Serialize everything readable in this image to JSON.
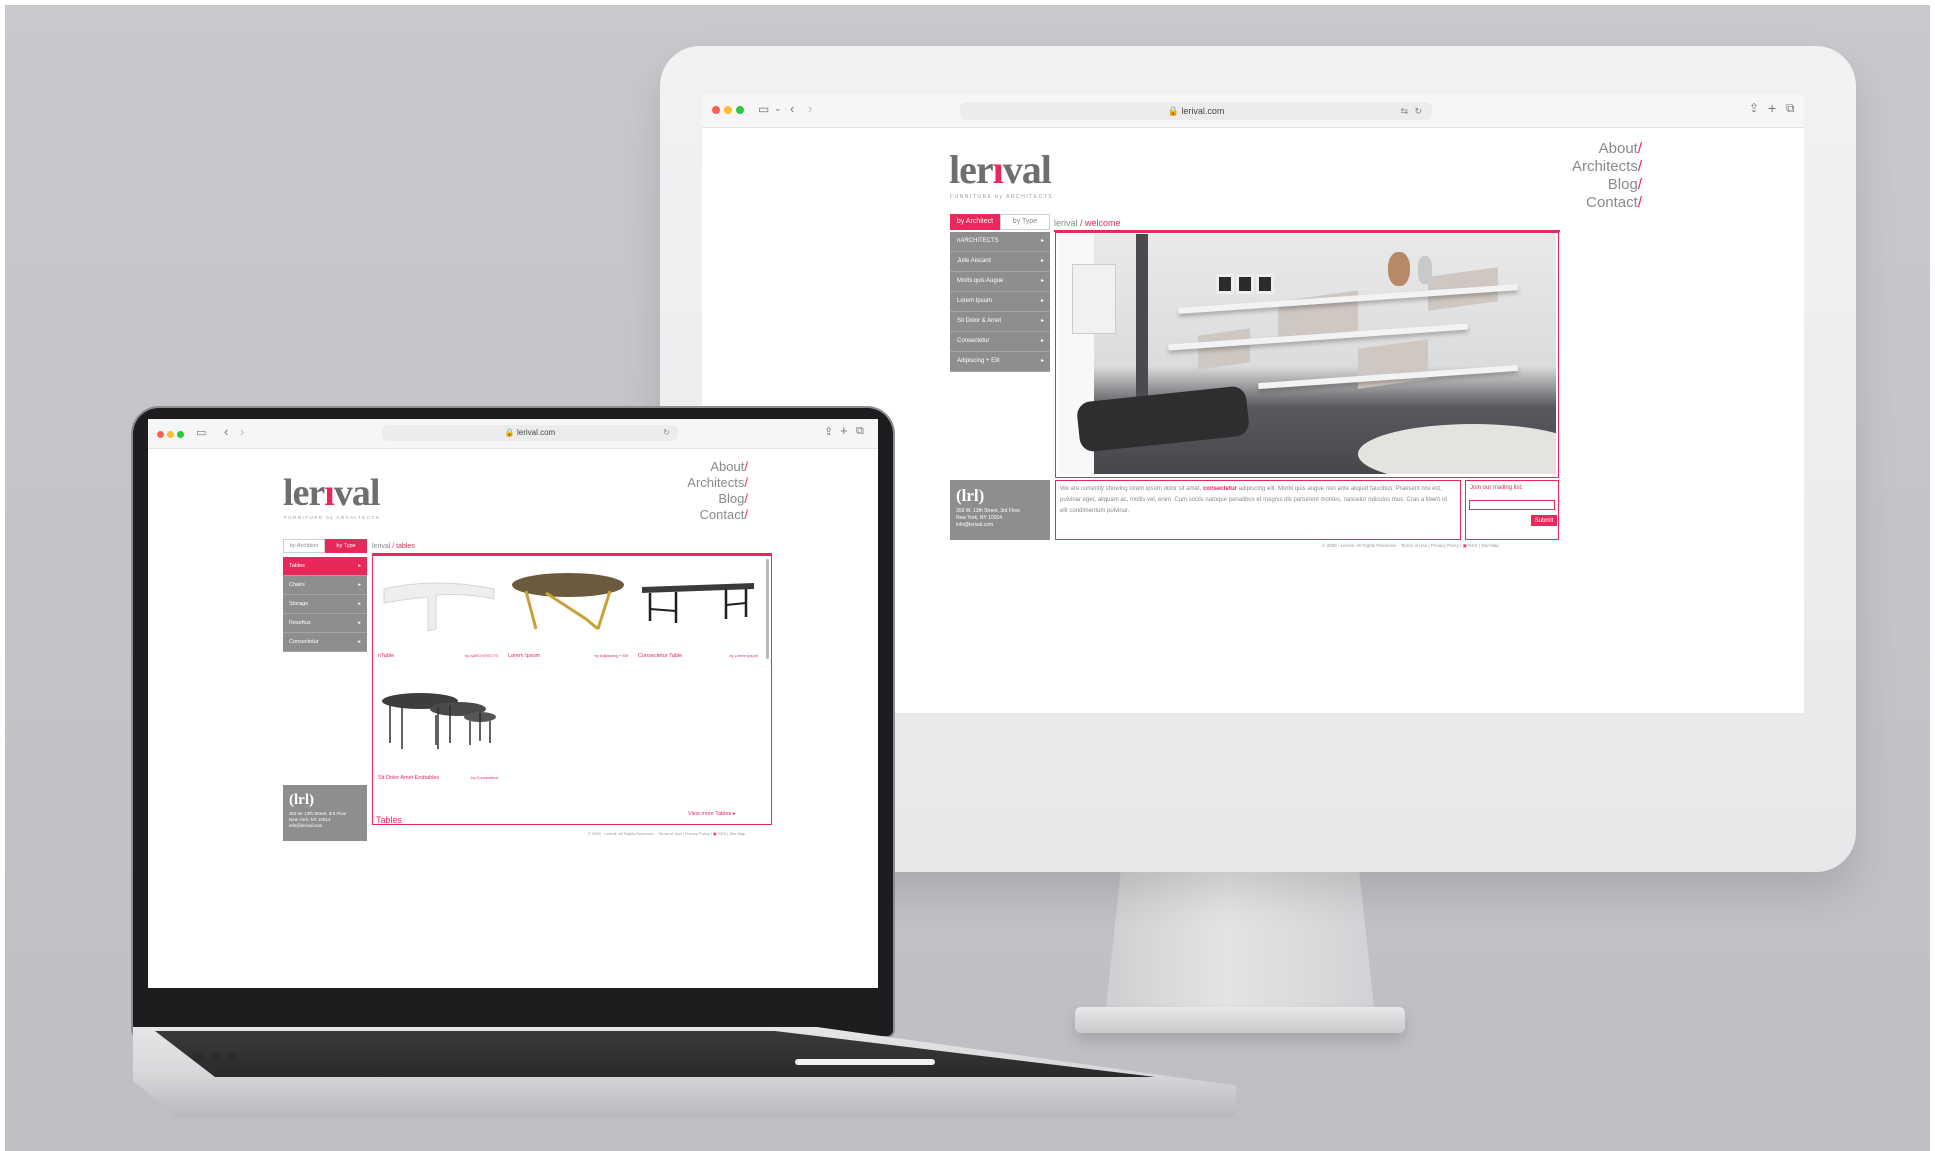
{
  "desktop": {
    "browser": {
      "url": "lerival.com",
      "toolbar_icons": [
        "sidebar-icon",
        "chevron-down-icon",
        "back-icon",
        "forward-icon",
        "share-icon",
        "new-tab-icon",
        "tabs-overview-icon",
        "translate-icon",
        "reload-icon",
        "lock-icon"
      ]
    },
    "site": {
      "logo_text_a": "ler",
      "logo_text_b": "ı",
      "logo_text_c": "val",
      "tagline": "FURNITURE by ARCHITECTS",
      "nav": [
        "About",
        "Architects",
        "Blog",
        "Contact"
      ],
      "nav_slash": "/",
      "tabs": {
        "by_architect": "by Architect",
        "by_type": "by Type"
      },
      "menu": [
        "nARCHITECTS",
        "Julie Aiscard",
        "Morbi quis Augue",
        "Lorem Ipsum",
        "Sit Dolor & Amet",
        "Consectetur",
        "Adipiscing + Elit"
      ],
      "menu_arrow": "▸",
      "breadcrumb_root": "lerival",
      "breadcrumb_sep": " / ",
      "breadcrumb_current": "welcome",
      "address": {
        "mark": "(lrl)",
        "line1": "303 W. 13th Street, 3rd Floor",
        "line2": "New York, NY 10014",
        "line3": "info@lerival.com"
      },
      "intro_a": "We are currently showing lorem ipsum dolor sit amet, ",
      "intro_link": "consectetur",
      "intro_b": " adipiscing elit. Morbi quis augue non ante aliquet faucibus. Praesent nisi est, pulvinar eget, aliquam ac, mollis vel, enim. Cum sociis natoque penatibus et magnis dis parturient montes, nascetur ridiculus mus. Cras a libero id elit condimentum pulvinar.",
      "mailing_label": "Join our mailing list:",
      "submit": "Submit",
      "footer": "© 2009 - Lerival. All Rights Reserved.",
      "footer_links": [
        "Terms of Use",
        "Privacy Policy",
        "RSS",
        "Site Map"
      ]
    }
  },
  "laptop": {
    "browser": {
      "url": "lerival.com"
    },
    "site": {
      "logo_text_a": "ler",
      "logo_text_b": "ı",
      "logo_text_c": "val",
      "tagline": "FURNITURE by ARCHITECTS",
      "nav": [
        "About",
        "Architects",
        "Blog",
        "Contact"
      ],
      "nav_slash": "/",
      "tabs": {
        "by_architect": "by Architect",
        "by_type": "by Type"
      },
      "menu": [
        "Tables",
        "Chairs",
        "Storage",
        "Reseftus",
        "Consectetur"
      ],
      "menu_arrow": "▸",
      "breadcrumb_root": "lerival",
      "breadcrumb_sep": " / ",
      "breadcrumb_current": "tables",
      "products": [
        {
          "title": "nTable",
          "by": "by nARCHITECTS"
        },
        {
          "title": "Lorem Ipsum",
          "by": "by Adipiscing + Elit"
        },
        {
          "title": "Consectetur Table",
          "by": "by Lorem Ipsum"
        },
        {
          "title": "Sit Dolor Amet Endtables",
          "by": "by Consectetur"
        }
      ],
      "view_more": "View more Tables",
      "section_title": "Tables",
      "address": {
        "mark": "(lrl)",
        "line1": "303 W. 13th Street, 3rd Floor",
        "line2": "New York, NY 10014",
        "line3": "info@lerival.com"
      },
      "footer": "© 2009 - Lerival. All Rights Reserved.",
      "footer_links": [
        "Terms of Use",
        "Privacy Policy",
        "RSS",
        "Site Map"
      ]
    }
  },
  "colors": {
    "accent": "#e8275a",
    "menu_gray": "#8e8e91",
    "text_gray": "#8a8a8c"
  }
}
